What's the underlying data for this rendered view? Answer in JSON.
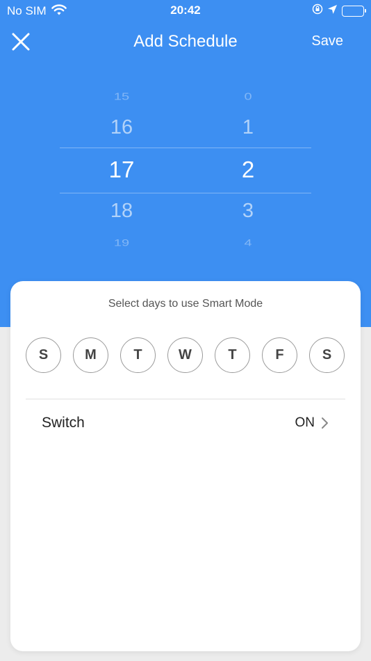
{
  "status_bar": {
    "carrier": "No SIM",
    "time": "20:42",
    "icons": [
      "wifi-icon",
      "orientation-lock-icon",
      "location-arrow-icon",
      "battery-icon"
    ]
  },
  "nav": {
    "close_icon": "close-icon",
    "title": "Add Schedule",
    "save_label": "Save"
  },
  "picker": {
    "hours": [
      "15",
      "16",
      "17",
      "18",
      "19"
    ],
    "minutes": [
      "0",
      "1",
      "2",
      "3",
      "4"
    ],
    "selected_hour": "17",
    "selected_minute": "2"
  },
  "card": {
    "prompt": "Select days to use Smart Mode",
    "days": [
      "S",
      "M",
      "T",
      "W",
      "T",
      "F",
      "S"
    ],
    "switch_row": {
      "label": "Switch",
      "value": "ON"
    }
  },
  "colors": {
    "accent": "#3d8ff2",
    "background": "#ececec",
    "card": "#ffffff"
  }
}
